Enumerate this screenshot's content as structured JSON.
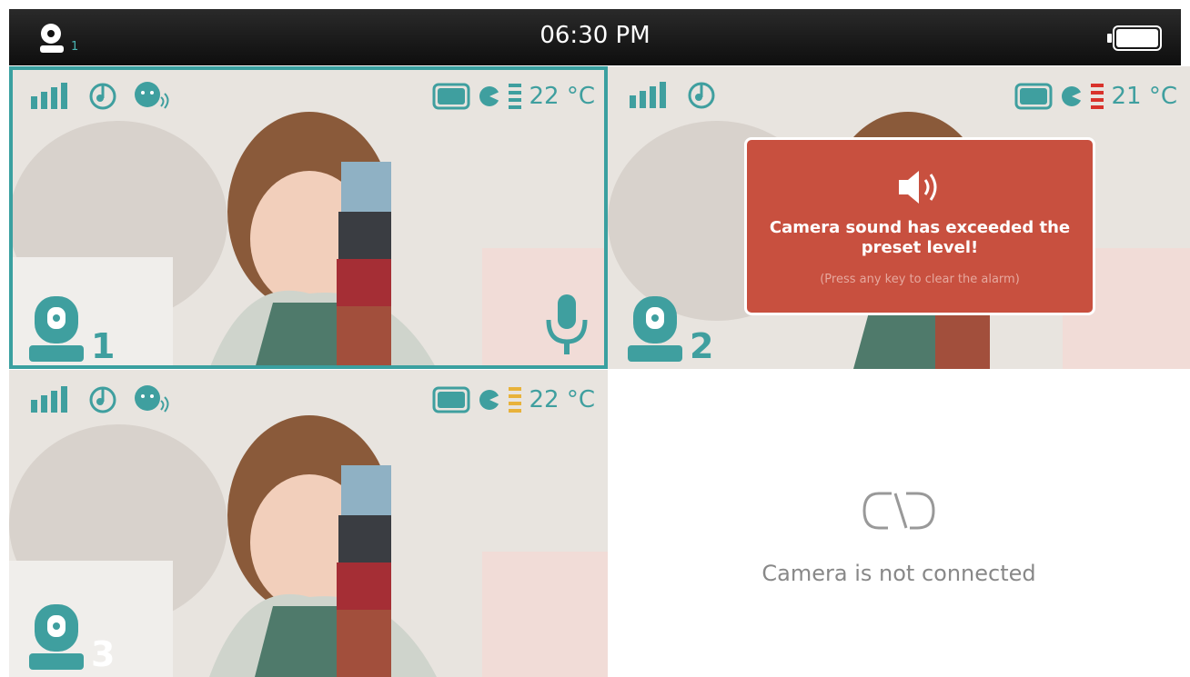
{
  "status_bar": {
    "camera_indicator": "1",
    "time": "06:30 PM",
    "battery_icon": "battery-full-icon"
  },
  "panes": [
    {
      "camera_number": "1",
      "temperature": "22 °C",
      "selected": true,
      "mic_active": true,
      "lullaby_icon": "music-note-icon",
      "vox_icon": "baby-face-icon",
      "temp_level": "high"
    },
    {
      "camera_number": "2",
      "temperature": "21 °C",
      "selected": false,
      "temp_level": "high",
      "alarm": {
        "message": "Camera sound has exceeded the preset level!",
        "hint": "(Press any key to clear the alarm)"
      }
    },
    {
      "camera_number": "3",
      "temperature": "22 °C",
      "selected": false,
      "temp_level": "medium"
    },
    {
      "not_connected_text": "Camera is not connected"
    }
  ],
  "colors": {
    "accent": "#3f9f9f",
    "alarm_bg": "#c8503f",
    "temp_red": "#d9322b",
    "temp_yellow": "#e8b23a"
  }
}
